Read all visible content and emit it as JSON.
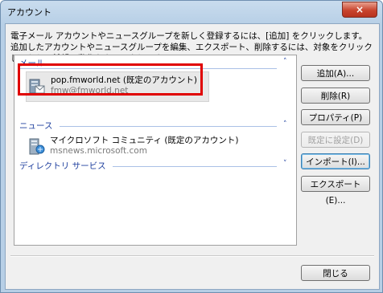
{
  "window": {
    "title": "アカウント",
    "close_label": "×"
  },
  "description": "電子メール アカウントやニュースグループを新しく登録するには、[追加] をクリックします。追加したアカウントやニュースグループを編集、エクスポート、削除するには、対象をクリックしてから、希望の動作をクリックします。",
  "groups": {
    "mail": {
      "label": "メール",
      "chevron": "˄"
    },
    "news": {
      "label": "ニュース",
      "chevron": "˄"
    },
    "directory": {
      "label": "ディレクトリ サービス",
      "chevron": "˅"
    }
  },
  "accounts": {
    "mail": {
      "name": "pop.fmworld.net (既定のアカウント)",
      "address": "fmw@fmworld.net"
    },
    "news": {
      "name": "マイクロソフト コミュニティ (既定のアカウント)",
      "address": "msnews.microsoft.com"
    }
  },
  "buttons": {
    "add": "追加(A)...",
    "remove": "削除(R)",
    "properties": "プロパティ(P)",
    "set_default": "既定に設定(D)",
    "import": "インポート(I)...",
    "export": "エクスポート(E)...",
    "close": "閉じる"
  },
  "colors": {
    "highlight": "#e00000",
    "group_text": "#1e3f9e"
  }
}
